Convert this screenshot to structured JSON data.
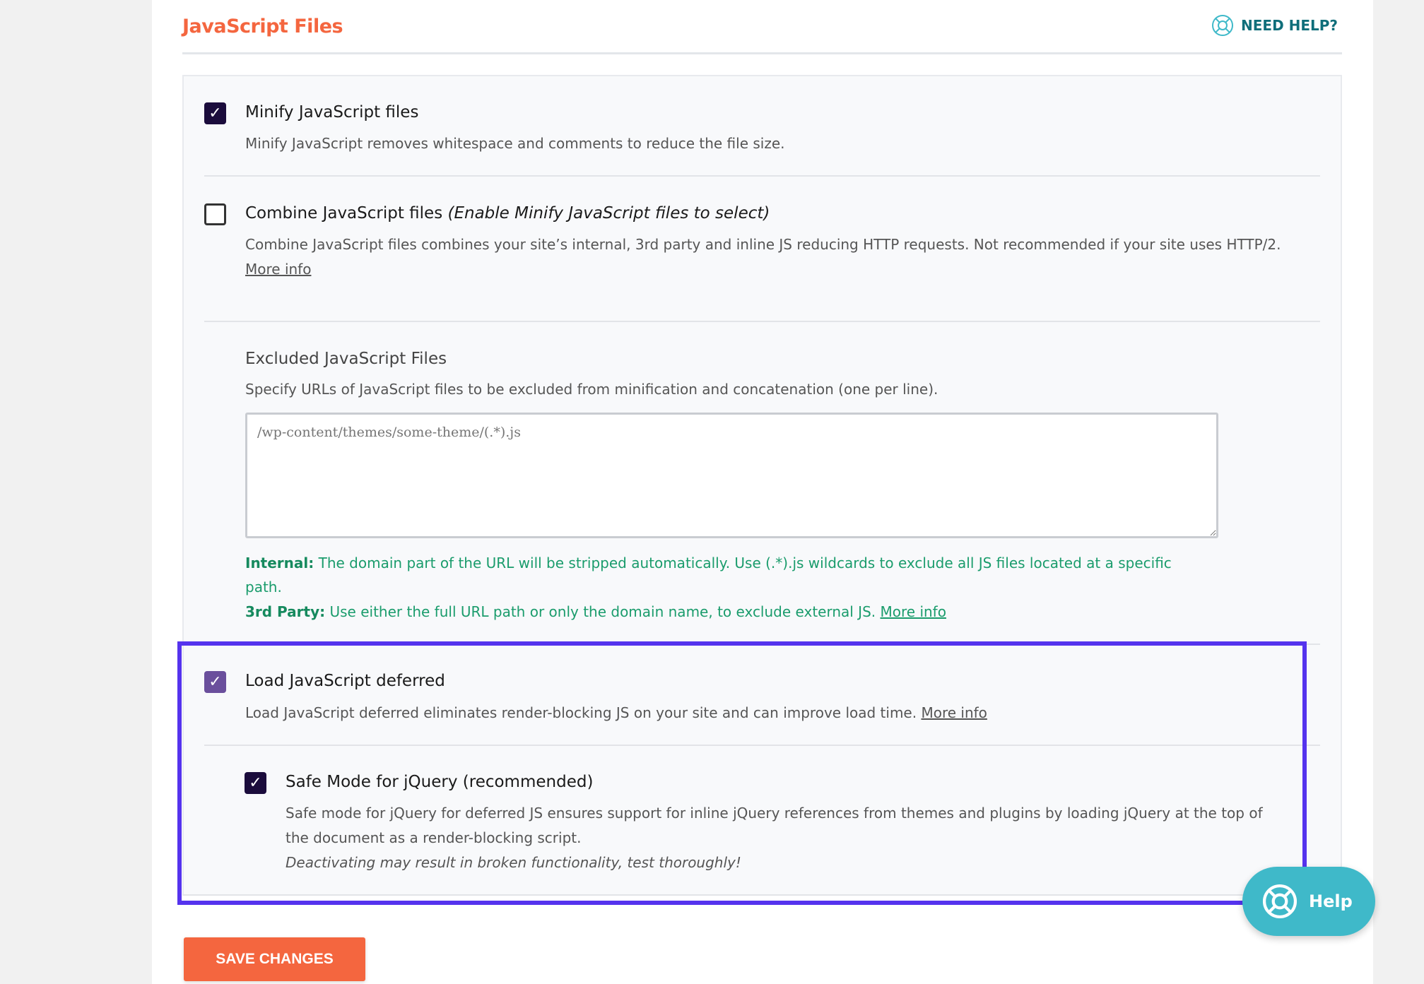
{
  "header": {
    "title": "JavaScript Files",
    "need_help": "NEED HELP?",
    "help_icon": "lifebuoy-icon"
  },
  "options": {
    "minify": {
      "checked": true,
      "label": "Minify JavaScript files",
      "desc": "Minify JavaScript removes whitespace and comments to reduce the file size."
    },
    "combine": {
      "checked": false,
      "label": "Combine JavaScript files",
      "label_note": "(Enable Minify JavaScript files to select)",
      "desc": "Combine JavaScript files combines your site’s internal, 3rd party and inline JS reducing HTTP requests. Not recommended if your site uses HTTP/2.",
      "more": "More info"
    },
    "excluded": {
      "label": "Excluded JavaScript Files",
      "desc": "Specify URLs of JavaScript files to be excluded from minification and concatenation (one per line).",
      "placeholder": "/wp-content/themes/some-theme/(.*).js",
      "internal_label": "Internal:",
      "internal_text": "The domain part of the URL will be stripped automatically. Use (.*).js wildcards to exclude all JS files located at a specific",
      "internal_text2": "path.",
      "third_label": "3rd Party:",
      "third_text": "Use either the full URL path or only the domain name, to exclude external JS.",
      "more": "More info"
    },
    "defer": {
      "checked": true,
      "label": "Load JavaScript deferred",
      "desc": "Load JavaScript deferred eliminates render-blocking JS on your site and can improve load time.",
      "more": "More info"
    },
    "safemode": {
      "checked": true,
      "label": "Safe Mode for jQuery (recommended)",
      "desc1": "Safe mode for jQuery for deferred JS ensures support for inline jQuery references from themes and plugins by loading jQuery at the top of",
      "desc2": "the document as a render-blocking script.",
      "warning": "Deactivating may result in broken functionality, test thoroughly!"
    }
  },
  "save_label": "SAVE CHANGES",
  "help_bubble": "Help",
  "colors": {
    "accent": "#f4663f",
    "highlight": "#5533ee",
    "help": "#3fb9c9",
    "success_text": "#1a9c6c"
  }
}
